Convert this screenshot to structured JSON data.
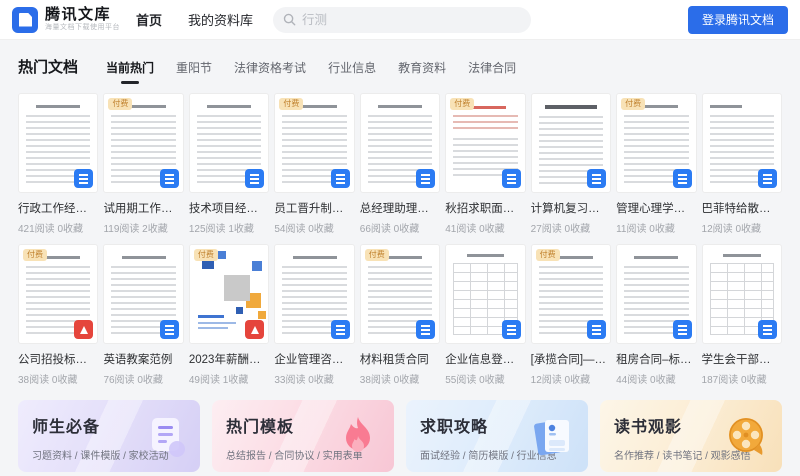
{
  "labels": {
    "paid_badge": "付费"
  },
  "header": {
    "logo_title": "腾讯文库",
    "logo_tagline": "海量文档下载使用平台",
    "nav": [
      {
        "label": "首页",
        "active": true
      },
      {
        "label": "我的资料库",
        "active": false
      }
    ],
    "search_placeholder": "行测",
    "login_button": "登录腾讯文档"
  },
  "section": {
    "title": "热门文档",
    "tabs": [
      {
        "label": "当前热门",
        "active": true
      },
      {
        "label": "重阳节",
        "active": false
      },
      {
        "label": "法律资格考试",
        "active": false
      },
      {
        "label": "行业信息",
        "active": false
      },
      {
        "label": "教育资料",
        "active": false
      },
      {
        "label": "法律合同",
        "active": false
      }
    ]
  },
  "documents": {
    "row1": [
      {
        "title": "行政工作经验分...",
        "stats": "421阅读 0收藏",
        "paid": false,
        "icon": "doc",
        "variant": "text"
      },
      {
        "title": "试用期工作经验...",
        "stats": "119阅读 2收藏",
        "paid": true,
        "icon": "doc",
        "variant": "text"
      },
      {
        "title": "技术项目经理面...",
        "stats": "125阅读 1收藏",
        "paid": false,
        "icon": "doc",
        "variant": "text"
      },
      {
        "title": "员工晋升制度及...",
        "stats": "54阅读 0收藏",
        "paid": true,
        "icon": "doc",
        "variant": "text"
      },
      {
        "title": "总经理助理工作...",
        "stats": "66阅读 0收藏",
        "paid": false,
        "icon": "doc",
        "variant": "text"
      },
      {
        "title": "秋招求职面试技巧",
        "stats": "41阅读 0收藏",
        "paid": true,
        "icon": "doc",
        "variant": "text-red"
      },
      {
        "title": "计算机复习资料",
        "stats": "27阅读 0收藏",
        "paid": false,
        "icon": "doc",
        "variant": "bold-title"
      },
      {
        "title": "管理心理学—复习...",
        "stats": "11阅读 0收藏",
        "paid": true,
        "icon": "doc",
        "variant": "text"
      },
      {
        "title": "巴菲特给散户的9...",
        "stats": "12阅读 0收藏",
        "paid": false,
        "icon": "doc",
        "variant": "text-left"
      }
    ],
    "row2": [
      {
        "title": "公司招投标授权...",
        "stats": "38阅读 0收藏",
        "paid": true,
        "icon": "pdf",
        "variant": "text"
      },
      {
        "title": "英语教案范例",
        "stats": "76阅读 0收藏",
        "paid": false,
        "icon": "doc",
        "variant": "text"
      },
      {
        "title": "2023年薪酬报告...",
        "stats": "49阅读 1收藏",
        "paid": true,
        "icon": "pdf",
        "variant": "mosaic"
      },
      {
        "title": "企业管理咨询合同",
        "stats": "33阅读 0收藏",
        "paid": false,
        "icon": "doc",
        "variant": "text"
      },
      {
        "title": "材料租赁合同",
        "stats": "38阅读 0收藏",
        "paid": true,
        "icon": "doc",
        "variant": "text"
      },
      {
        "title": "企业信息登记表",
        "stats": "55阅读 0收藏",
        "paid": false,
        "icon": "doc",
        "variant": "table"
      },
      {
        "title": "[承揽合同]—加...",
        "stats": "12阅读 0收藏",
        "paid": true,
        "icon": "doc",
        "variant": "text"
      },
      {
        "title": "租房合同–标准版",
        "stats": "44阅读 0收藏",
        "paid": false,
        "icon": "doc",
        "variant": "text"
      },
      {
        "title": "学生会干部竞选...",
        "stats": "187阅读 0收藏",
        "paid": false,
        "icon": "doc",
        "variant": "table"
      }
    ]
  },
  "banners": [
    {
      "title": "师生必备",
      "subtitle": "习题资料 / 课件模版 / 家校活动",
      "theme": "purple",
      "icon": "document-icon"
    },
    {
      "title": "热门模板",
      "subtitle": "总结报告 / 合同协议 / 实用表单",
      "theme": "pink",
      "icon": "flame-icon"
    },
    {
      "title": "求职攻略",
      "subtitle": "面试经验 / 简历模版 / 行业信息",
      "theme": "blue",
      "icon": "resume-icon"
    },
    {
      "title": "读书观影",
      "subtitle": "名作推荐 / 读书笔记 / 观影感悟",
      "theme": "orange",
      "icon": "film-reel-icon"
    }
  ],
  "colors": {
    "accent_blue": "#2b6de9",
    "paid_badge_bg": "#f8e2b6",
    "paid_badge_text": "#c0812e",
    "pdf_red": "#e5453c",
    "page_bg": "#f4f5f7"
  }
}
